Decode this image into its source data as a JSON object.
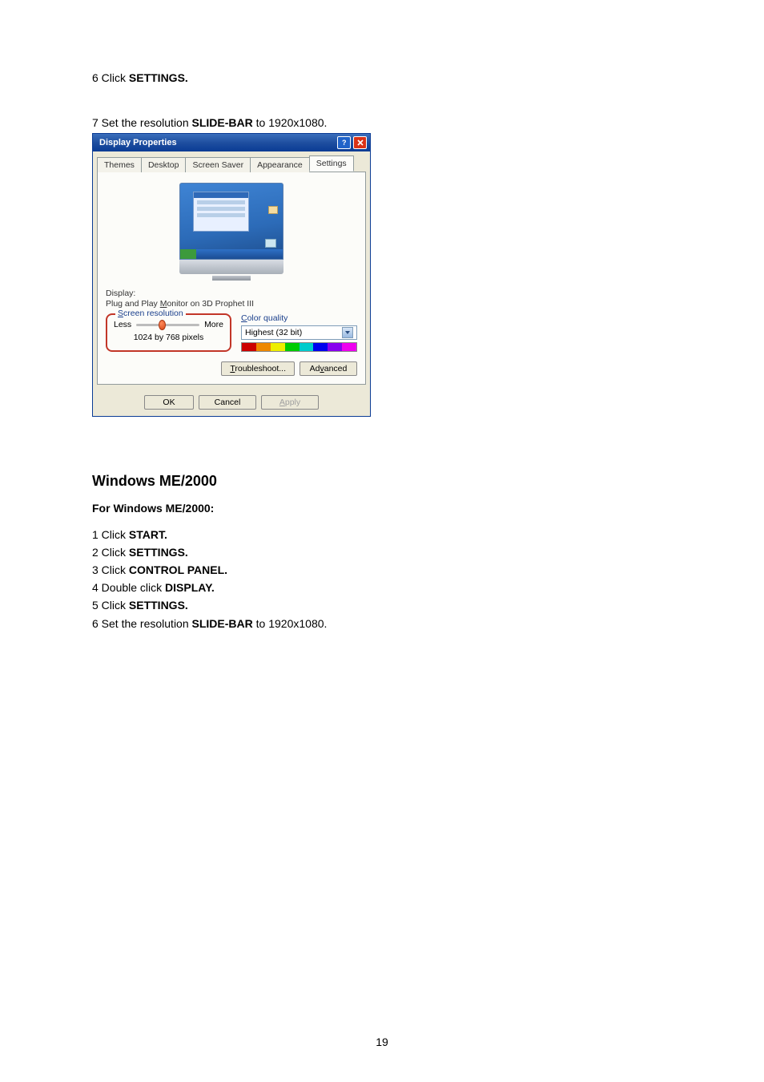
{
  "instructions_top": {
    "step6_pre": "6 Click ",
    "step6_bold": "SETTINGS.",
    "step7_pre": "7 Set the resolution ",
    "step7_bold": "SLIDE-BAR",
    "step7_post": "  to 1920x1080."
  },
  "dialog": {
    "title": "Display Properties",
    "tabs": [
      "Themes",
      "Desktop",
      "Screen Saver",
      "Appearance",
      "Settings"
    ],
    "active_tab": "Settings",
    "display_label": "Display:",
    "display_name_pre": "Plug and Play ",
    "display_name_ul": "M",
    "display_name_post": "onitor on 3D Prophet III",
    "screen_res_legend_ul": "S",
    "screen_res_legend_post": "creen resolution",
    "less": "Less",
    "more": "More",
    "current_res": "1024 by 768 pixels",
    "color_q_ul": "C",
    "color_q_post": "olor quality",
    "color_value": "Highest (32 bit)",
    "troubleshoot_ul": "T",
    "troubleshoot_post": "roubleshoot...",
    "advanced_pre": "Ad",
    "advanced_ul": "v",
    "advanced_post": "anced",
    "ok": "OK",
    "cancel": "Cancel",
    "apply_ul": "A",
    "apply_post": "pply"
  },
  "section2": {
    "heading": "Windows ME/2000",
    "sub": "For Windows ME/2000:",
    "s1_pre": "1 Click ",
    "s1_bold": "START.",
    "s2_pre": "2 Click ",
    "s2_bold": "SETTINGS.",
    "s3_pre": "3 Click ",
    "s3_bold": "CONTROL PANEL.",
    "s4_pre": "4 Double click ",
    "s4_bold": "DISPLAY.",
    "s5_pre": "5 Click ",
    "s5_bold": "SETTINGS.",
    "s6_pre": "6 Set the resolution ",
    "s6_bold": "SLIDE-BAR",
    "s6_post": "  to 1920x1080."
  },
  "page_number": "19"
}
